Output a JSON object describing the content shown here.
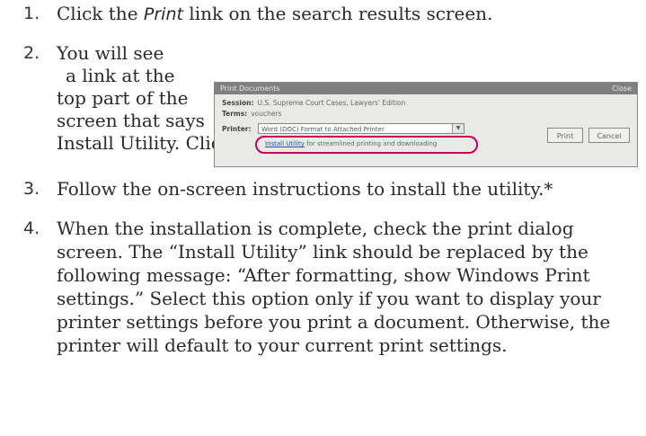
{
  "steps": [
    {
      "number": "1.",
      "pre": "Click the ",
      "emph": "Print",
      "post": " link on the search results screen."
    },
    {
      "number": "2.",
      "lines": [
        "You will see",
        "a link at the",
        "top part of the",
        "screen that says",
        "Install Utility. Click the link."
      ]
    },
    {
      "number": "3.",
      "text": "Follow the on-screen instructions to install the utility.*"
    },
    {
      "number": "4.",
      "text": "When the installation is complete, check the print dialog screen. The “Install Utility” link should be replaced by the following message: “After formatting, show Windows Print settings.” Select this option only if you want to display your printer settings before you print a document. Otherwise, the printer will default to your current print settings."
    }
  ],
  "dialog": {
    "title": "Print Documents",
    "close": "Close",
    "session_label": "Session:",
    "session_value": "U.S. Supreme Court Cases, Lawyers' Edition",
    "terms_label": "Terms:",
    "terms_value": "vouchers",
    "printer_label": "Printer:",
    "printer_value": "Word (DOC) Format to Attached Printer",
    "link_text": "Install Utility",
    "link_rest": " for streamlined printing and downloading",
    "print_button": "Print",
    "cancel_button": "Cancel",
    "highlight_color": "#c8005a"
  }
}
